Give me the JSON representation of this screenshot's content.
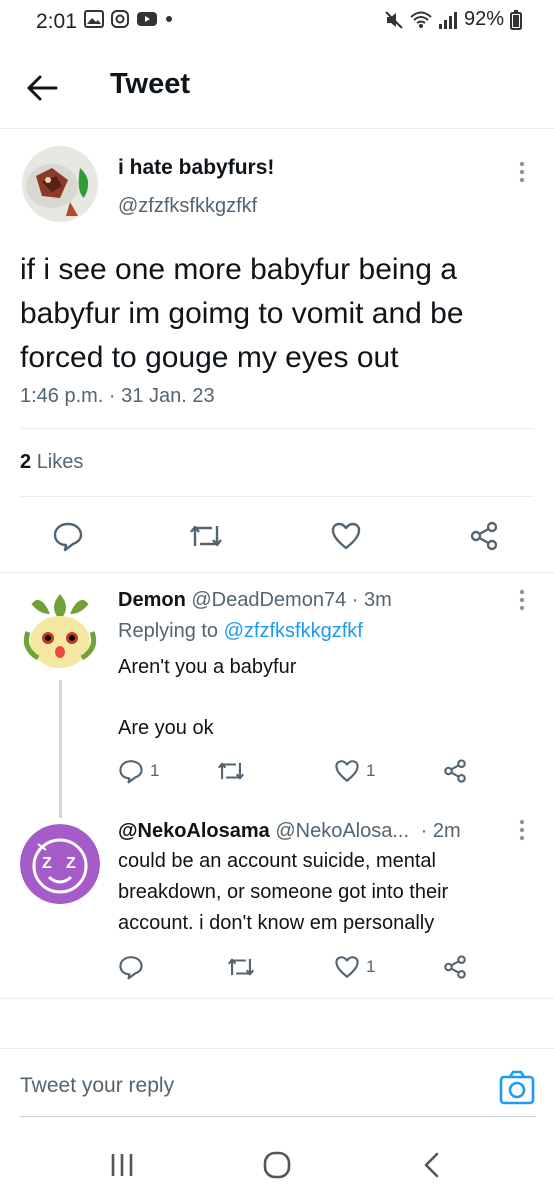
{
  "status_bar": {
    "time": "2:01",
    "battery": "92%"
  },
  "header": {
    "title": "Tweet"
  },
  "tweet": {
    "display_name": "i hate babyfurs!",
    "handle": "@zfzfksfkkgzfkf",
    "text": "if i see one more babyfur being a babyfur im goimg to vomit and be forced to gouge my eyes out",
    "timestamp": "1:46 p.m. · 31 Jan. 23",
    "likes_count": "2",
    "likes_label": "Likes"
  },
  "replies": [
    {
      "display_name": "Demon",
      "handle": "@DeadDemon74",
      "time": "· 3m",
      "replying_prefix": "Replying to",
      "replying_handle": "@zfzfksfkkgzfkf",
      "line1": "Aren't you a babyfur",
      "line2": "Are you ok",
      "reply_count": "1",
      "like_count": "1"
    },
    {
      "display_name": "@NekoAlosama",
      "handle": "@NekoAlosa...",
      "time": "· 2m",
      "text": "could be an account suicide, mental breakdown, or someone got into their account. i don't know em personally",
      "like_count": "1"
    }
  ],
  "compose": {
    "placeholder": "Tweet your reply"
  },
  "colors": {
    "accent": "#1d9bf0",
    "text": "#0f1419",
    "muted": "#536471"
  }
}
